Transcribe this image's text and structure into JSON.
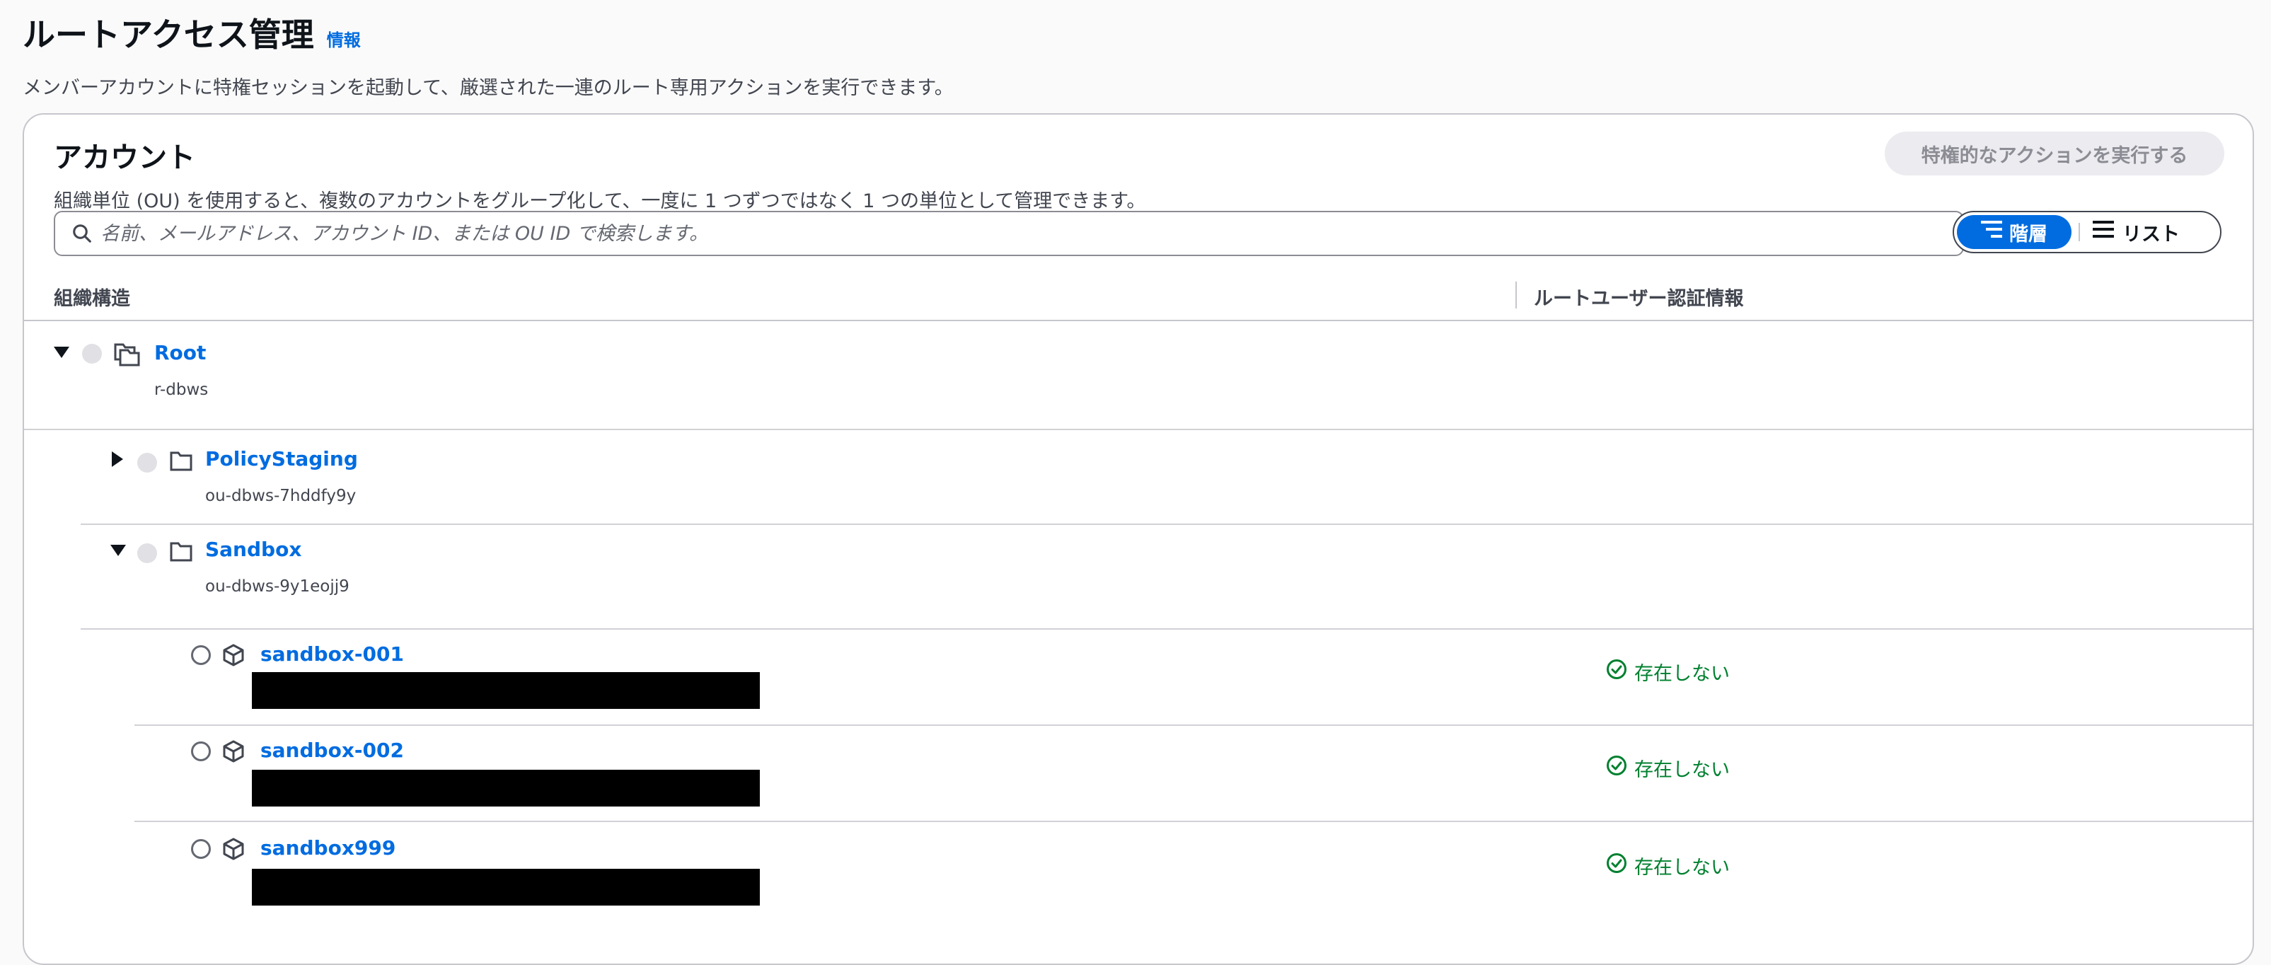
{
  "page": {
    "title": "ルートアクセス管理",
    "info_link": "情報",
    "description": "メンバーアカウントに特権セッションを起動して、厳選された一連のルート専用アクションを実行できます。"
  },
  "accounts_panel": {
    "title": "アカウント",
    "description": "組織単位 (OU) を使用すると、複数のアカウントをグループ化して、一度に 1 つずつではなく 1 つの単位として管理できます。",
    "privileged_action_button": "特権的なアクションを実行する",
    "search_placeholder": "名前、メールアドレス、アカウント ID、または OU ID で検索します。",
    "view_toggle": {
      "hierarchy_label": "階層",
      "list_label": "リスト",
      "selected": "階層"
    }
  },
  "table": {
    "columns": {
      "structure": "組織構造",
      "root_credentials": "ルートユーザー認証情報"
    },
    "rows": [
      {
        "type": "root",
        "name": "Root",
        "id": "r-dbws",
        "expanded": true
      },
      {
        "type": "ou",
        "name": "PolicyStaging",
        "id": "ou-dbws-7hddfy9y",
        "expanded": false
      },
      {
        "type": "ou",
        "name": "Sandbox",
        "id": "ou-dbws-9y1eojj9",
        "expanded": true
      },
      {
        "type": "account",
        "name": "sandbox-001",
        "credential_status": "存在しない"
      },
      {
        "type": "account",
        "name": "sandbox-002",
        "credential_status": "存在しない"
      },
      {
        "type": "account",
        "name": "sandbox999",
        "credential_status": "存在しない"
      }
    ]
  },
  "colors": {
    "link": "#006ce0",
    "success": "#00802f",
    "border": "#c6c6cd",
    "disabled_button": "#ebebf0"
  },
  "icons": {
    "search": "search-icon",
    "hierarchy": "hierarchy-icon",
    "list": "list-icon",
    "root": "root-folders-icon",
    "ou": "folder-icon",
    "account": "cube-icon",
    "status": "check-circle-icon",
    "expand": "caret-down-icon",
    "collapse": "caret-right-icon"
  }
}
